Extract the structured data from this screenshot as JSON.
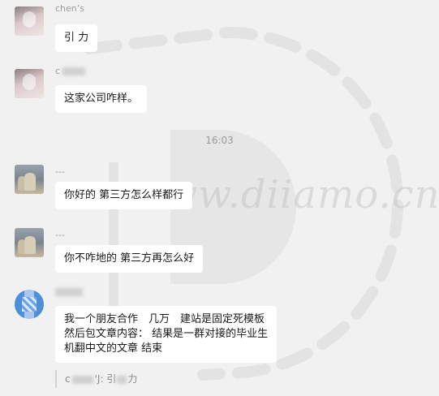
{
  "timestamp": "16:03",
  "watermark": {
    "text": "www.diiamo.cn"
  },
  "messages": [
    {
      "name": "chen’s",
      "text": "引 力"
    },
    {
      "name": "c",
      "text": "这家公司咋样。"
    },
    {
      "name": "---",
      "text": "你好的 第三方怎么样都行"
    },
    {
      "name": "---",
      "text": "你不咋地的 第三方再怎么好"
    },
    {
      "name": "",
      "lines": [
        "我一个朋友合作　几万　建站是固定死模板",
        "然后包文章内容： 结果是一群对接的毕业生",
        "机翻中文的文章 结束"
      ]
    }
  ],
  "quote": {
    "prefix": "c",
    "suffix": "'J: 引",
    "tail": "力"
  }
}
